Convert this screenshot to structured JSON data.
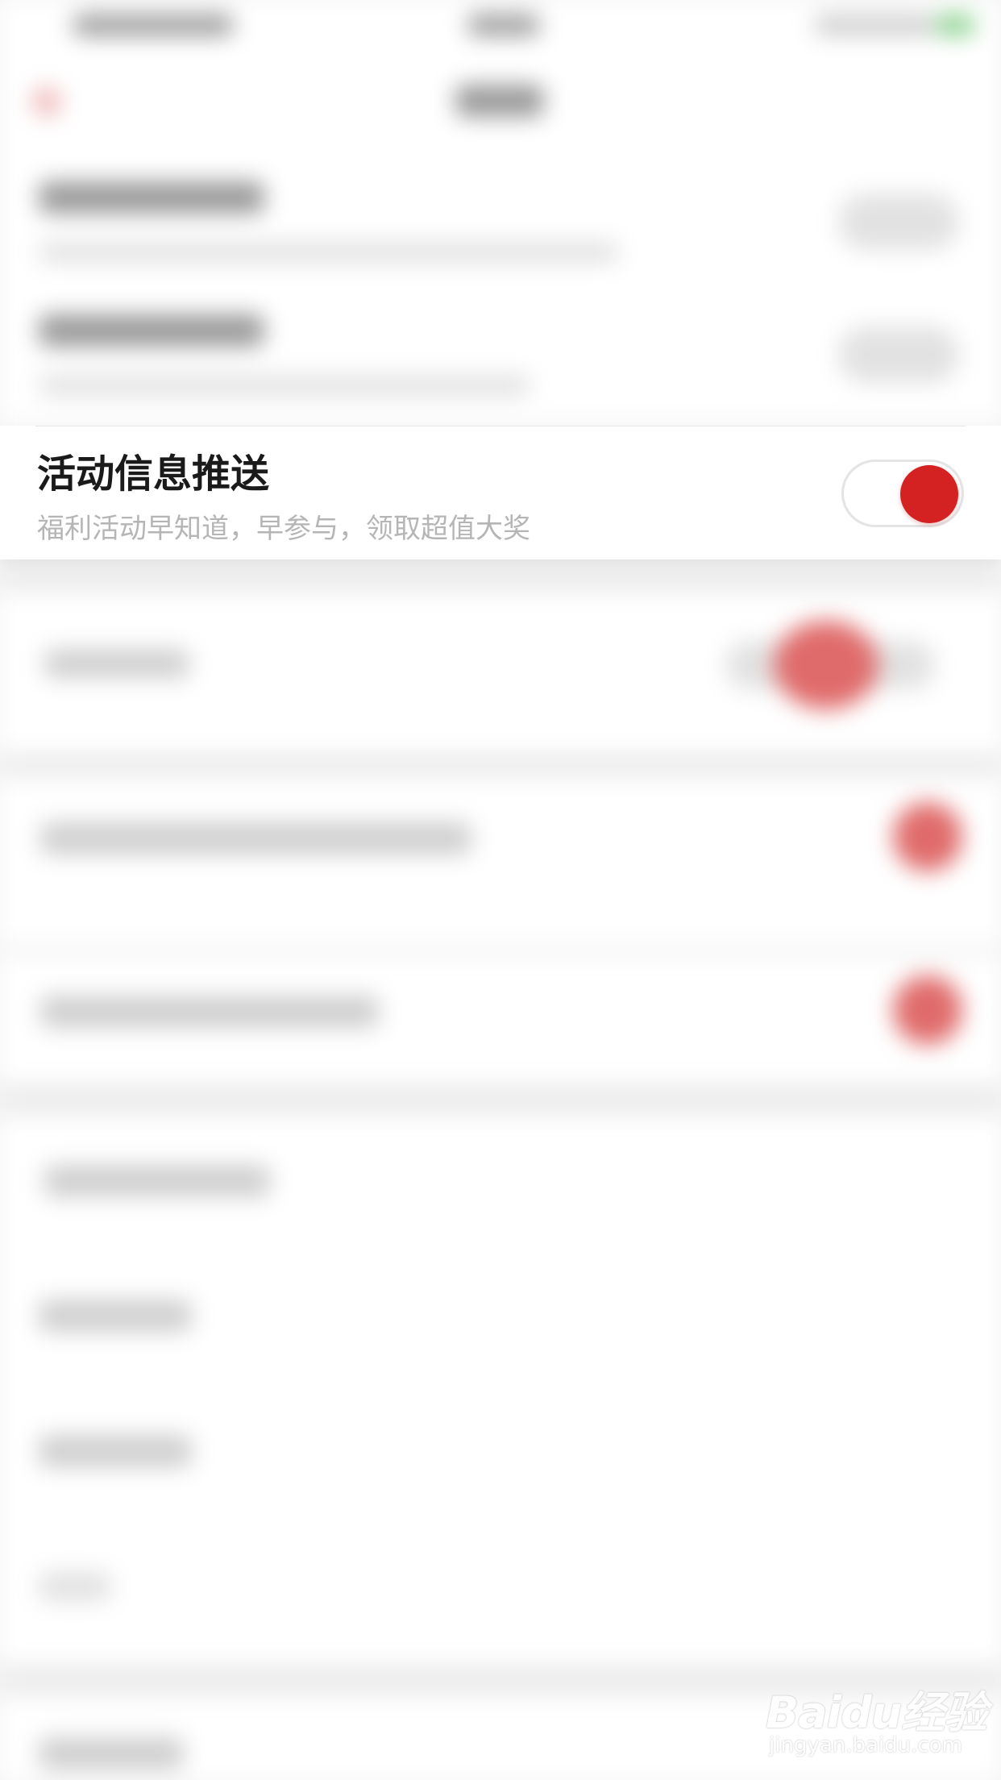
{
  "setting": {
    "title": "活动信息推送",
    "subtitle": "福利活动早知道，早参与，领取超值大奖",
    "toggle_on": true
  },
  "colors": {
    "accent": "#d42222",
    "title_text": "#1a1a1a",
    "subtitle_text": "#b5b5b5",
    "background": "#f5f5f5"
  },
  "watermark": {
    "logo": "Baidu经验",
    "url": "jingyan.baidu.com"
  }
}
